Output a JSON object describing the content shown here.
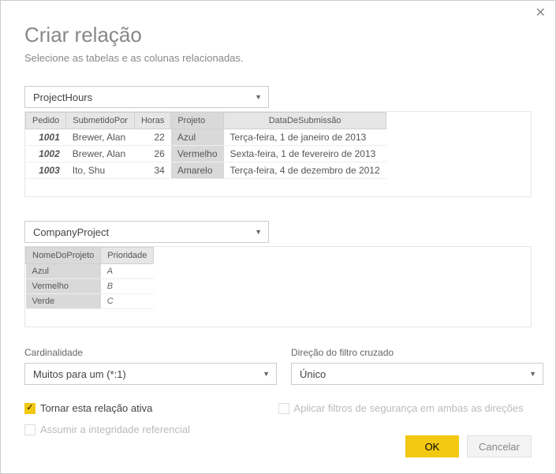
{
  "dialog": {
    "title": "Criar relação",
    "subtitle": "Selecione as tabelas e as colunas relacionadas."
  },
  "table1": {
    "dropdown": "ProjectHours",
    "headers": {
      "c0": "Pedido",
      "c1": "SubmetidoPor",
      "c2": "Horas",
      "c3": "Projeto",
      "c4": "DataDeSubmissão"
    },
    "rows": [
      {
        "c0": "1001",
        "c1": "Brewer, Alan",
        "c2": "22",
        "c3": "Azul",
        "c4": "Terça-feira, 1 de janeiro de 2013"
      },
      {
        "c0": "1002",
        "c1": "Brewer, Alan",
        "c2": "26",
        "c3": "Vermelho",
        "c4": "Sexta-feira, 1 de fevereiro de 2013"
      },
      {
        "c0": "1003",
        "c1": "Ito, Shu",
        "c2": "34",
        "c3": "Amarelo",
        "c4": "Terça-feira, 4 de dezembro de 2012"
      }
    ]
  },
  "table2": {
    "dropdown": "CompanyProject",
    "headers": {
      "c0": "NomeDoProjeto",
      "c1": "Prioridade"
    },
    "rows": [
      {
        "c0": "Azul",
        "c1": "A"
      },
      {
        "c0": "Vermelho",
        "c1": "B"
      },
      {
        "c0": "Verde",
        "c1": "C"
      }
    ]
  },
  "options": {
    "cardinality_label": "Cardinalidade",
    "cardinality_value": "Muitos para um (*:1)",
    "crossfilter_label": "Direção do filtro cruzado",
    "crossfilter_value": "Único",
    "active_label": "Tornar esta relação ativa",
    "security_label": "Aplicar filtros de segurança em ambas as direções",
    "integrity_label": "Assumir a integridade referencial"
  },
  "buttons": {
    "ok": "OK",
    "cancel": "Cancelar"
  }
}
